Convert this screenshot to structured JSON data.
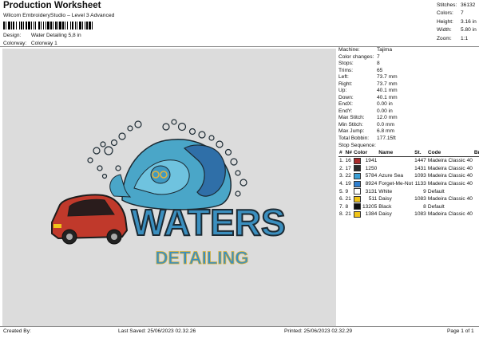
{
  "header": {
    "title": "Production Worksheet",
    "subtitle": "Wilcom EmbroideryStudio – Level 3 Advanced",
    "design_label": "Design:",
    "design_value": "Water Detailing 5,8 in",
    "colorway_label": "Colorway:",
    "colorway_value": "Colorway 1"
  },
  "stats": [
    {
      "k": "Stitches:",
      "v": "36132"
    },
    {
      "k": "Colors:",
      "v": "7"
    },
    {
      "k": "Height:",
      "v": "3.16 in"
    },
    {
      "k": "Width:",
      "v": "5.80 in"
    },
    {
      "k": "Zoom:",
      "v": "1:1"
    }
  ],
  "machine_info": [
    {
      "k": "Machine:",
      "v": "Tajima"
    },
    {
      "k": "Color changes:",
      "v": "7"
    },
    {
      "k": "Stops:",
      "v": "8"
    },
    {
      "k": "Trims:",
      "v": "65"
    },
    {
      "k": "Left:",
      "v": "73.7 mm"
    },
    {
      "k": "Right:",
      "v": "73.7 mm"
    },
    {
      "k": "Up:",
      "v": "40.1 mm"
    },
    {
      "k": "Down:",
      "v": "40.1 mm"
    },
    {
      "k": "EndX:",
      "v": "0.00 in"
    },
    {
      "k": "EndY:",
      "v": "0.00 in"
    },
    {
      "k": "Max Stitch:",
      "v": "12.0 mm"
    },
    {
      "k": "Min Stitch:",
      "v": "0.0 mm"
    },
    {
      "k": "Max Jump:",
      "v": "6.8 mm"
    },
    {
      "k": "Total Bobbin:",
      "v": "177.15ft"
    }
  ],
  "stop_sequence": {
    "title": "Stop Sequence:",
    "headers": [
      "#",
      "N#",
      "Color",
      "Name",
      "St.",
      "Code",
      "Brand"
    ],
    "rows": [
      {
        "idx": "1.",
        "n": "16",
        "color": "#a82a2a",
        "num": "1941",
        "name": "",
        "st": "1447",
        "code": "Madeira Classic 40"
      },
      {
        "idx": "2.",
        "n": "17",
        "color": "#2a2a2a",
        "num": "1250",
        "name": "",
        "st": "1431",
        "code": "Madeira Classic 40"
      },
      {
        "idx": "3.",
        "n": "22",
        "color": "#3a9fd6",
        "num": "5784",
        "name": "Azure Sea",
        "st": "1093",
        "code": "Madeira Classic 40"
      },
      {
        "idx": "4.",
        "n": "19",
        "color": "#2f7fcf",
        "num": "8924",
        "name": "Forget-Me-Not",
        "st": "1133",
        "code": "Madeira Classic 40"
      },
      {
        "idx": "5.",
        "n": "9",
        "color": "#ffffff",
        "num": "3131",
        "name": "White",
        "st": "9",
        "code": "Default"
      },
      {
        "idx": "6.",
        "n": "21",
        "color": "#f0c419",
        "num": "511",
        "name": "Daisy",
        "st": "1083",
        "code": "Madeira Classic 40"
      },
      {
        "idx": "7.",
        "n": "8",
        "color": "#111111",
        "num": "13205",
        "name": "Black",
        "st": "8",
        "code": "Default"
      },
      {
        "idx": "8.",
        "n": "21",
        "color": "#f0c419",
        "num": "1384",
        "name": "Daisy",
        "st": "1083",
        "code": "Madeira Classic 40"
      }
    ]
  },
  "design_art": {
    "word1": "WATERS",
    "word2": "DETAILING"
  },
  "footer": {
    "created": "Created By:",
    "saved": "Last Saved: 25/06/2023 02.32.26",
    "printed": "Printed: 25/06/2023 02.32.29",
    "page": "Page 1 of 1"
  }
}
